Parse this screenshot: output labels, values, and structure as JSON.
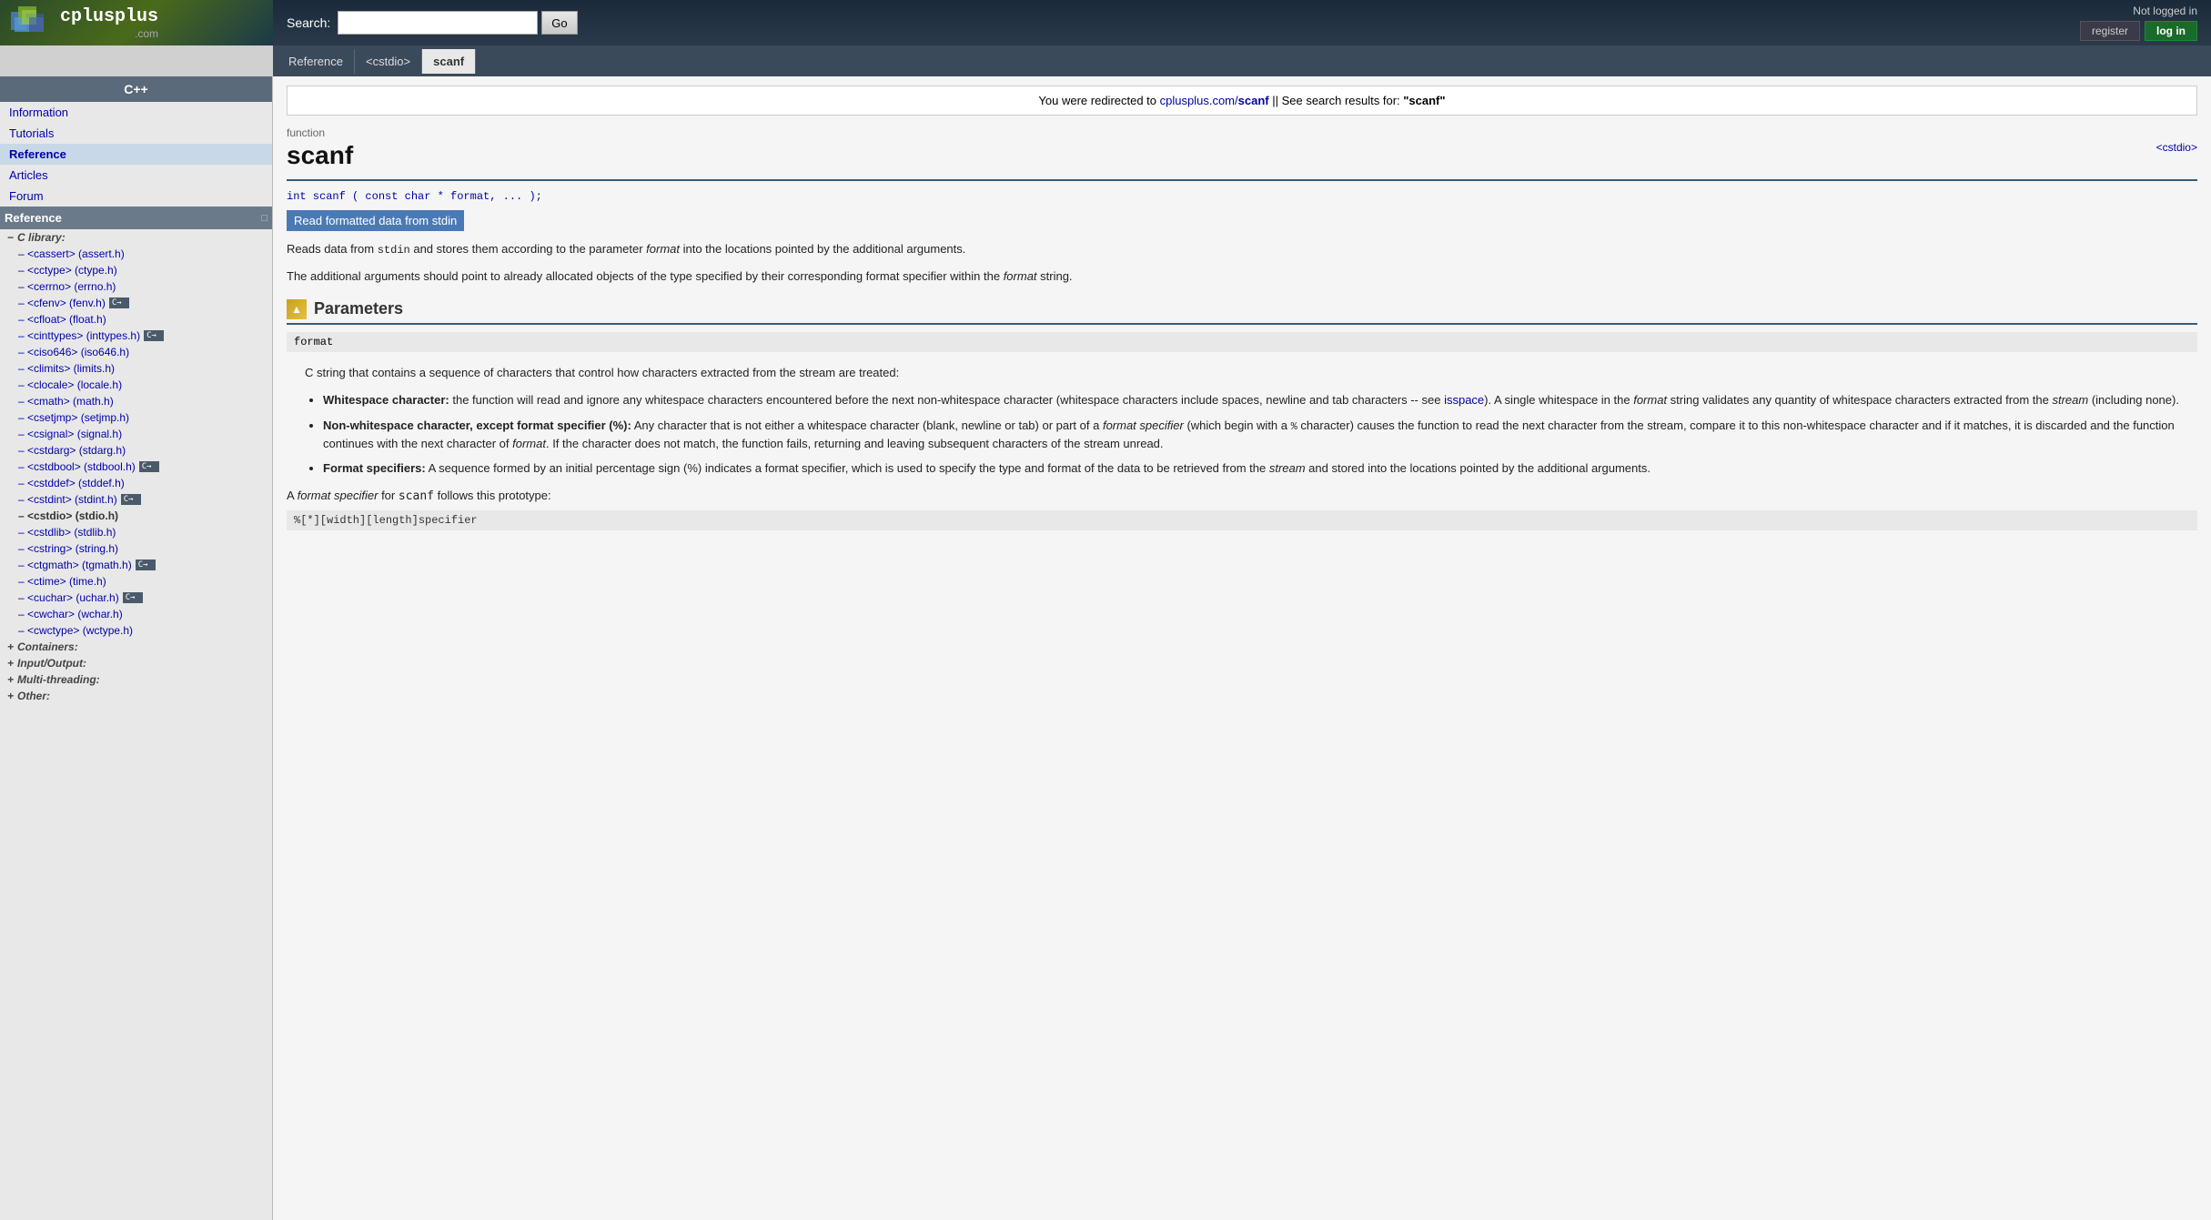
{
  "header": {
    "search_label": "Search:",
    "search_placeholder": "",
    "search_button": "Go",
    "not_logged_in": "Not logged in",
    "register": "register",
    "login": "log in",
    "logo_text": "cplusplus",
    "logo_dot_com": ".com"
  },
  "breadcrumb": {
    "items": [
      "Reference",
      "<cstdio>",
      "scanf"
    ]
  },
  "sidebar": {
    "cpp_section": "C++",
    "nav_items": [
      {
        "label": "Information",
        "bold": false
      },
      {
        "label": "Tutorials",
        "bold": false
      },
      {
        "label": "Reference",
        "bold": true
      },
      {
        "label": "Articles",
        "bold": false
      },
      {
        "label": "Forum",
        "bold": false
      }
    ],
    "reference_section": "Reference",
    "tree": {
      "c_library_label": "C library:",
      "items": [
        {
          "label": "<cassert> (assert.h)",
          "indent": true,
          "c11": false,
          "active": false
        },
        {
          "label": "<cctype> (ctype.h)",
          "indent": true,
          "c11": false,
          "active": false
        },
        {
          "label": "<cerrno> (errno.h)",
          "indent": true,
          "c11": false,
          "active": false
        },
        {
          "label": "<cfenv> (fenv.h)",
          "indent": true,
          "c11": true,
          "active": false
        },
        {
          "label": "<cfloat> (float.h)",
          "indent": true,
          "c11": false,
          "active": false
        },
        {
          "label": "<cinttypes> (inttypes.h)",
          "indent": true,
          "c11": true,
          "active": false
        },
        {
          "label": "<ciso646> (iso646.h)",
          "indent": true,
          "c11": false,
          "active": false
        },
        {
          "label": "<climits> (limits.h)",
          "indent": true,
          "c11": false,
          "active": false
        },
        {
          "label": "<clocale> (locale.h)",
          "indent": true,
          "c11": false,
          "active": false
        },
        {
          "label": "<cmath> (math.h)",
          "indent": true,
          "c11": false,
          "active": false
        },
        {
          "label": "<csetjmp> (setjmp.h)",
          "indent": true,
          "c11": false,
          "active": false
        },
        {
          "label": "<csignal> (signal.h)",
          "indent": true,
          "c11": false,
          "active": false
        },
        {
          "label": "<cstdarg> (stdarg.h)",
          "indent": true,
          "c11": false,
          "active": false
        },
        {
          "label": "<cstdbool> (stdbool.h)",
          "indent": true,
          "c11": true,
          "active": false
        },
        {
          "label": "<cstddef> (stddef.h)",
          "indent": true,
          "c11": false,
          "active": false
        },
        {
          "label": "<cstdint> (stdint.h)",
          "indent": true,
          "c11": true,
          "active": false
        },
        {
          "label": "<cstdio> (stdio.h)",
          "indent": true,
          "c11": false,
          "active": true
        },
        {
          "label": "<cstdlib> (stdlib.h)",
          "indent": true,
          "c11": false,
          "active": false
        },
        {
          "label": "<cstring> (string.h)",
          "indent": true,
          "c11": false,
          "active": false
        },
        {
          "label": "<ctgmath> (tgmath.h)",
          "indent": true,
          "c11": true,
          "active": false
        },
        {
          "label": "<ctime> (time.h)",
          "indent": true,
          "c11": false,
          "active": false
        },
        {
          "label": "<cuchar> (uchar.h)",
          "indent": true,
          "c11": true,
          "active": false
        },
        {
          "label": "<cwchar> (wchar.h)",
          "indent": true,
          "c11": false,
          "active": false
        },
        {
          "label": "<cwctype> (wctype.h)",
          "indent": true,
          "c11": false,
          "active": false
        }
      ],
      "containers_label": "Containers:",
      "input_output_label": "Input/Output:",
      "multi_threading_label": "Multi-threading:",
      "other_label": "Other:"
    }
  },
  "main": {
    "redirect_notice_1": "You were redirected to cplusplus.com/",
    "redirect_bold": "scanf",
    "redirect_notice_2": " || See search results for: ",
    "redirect_search": "\"scanf\"",
    "function_type": "function",
    "function_name": "scanf",
    "cstdio_link": "<cstdio>",
    "syntax": "int scanf ( const char * format, ... );",
    "description_highlight": "Read formatted data from stdin",
    "desc1": "Reads data from stdin and stores them according to the parameter format into the locations pointed by the additional arguments.",
    "desc2": "The additional arguments should point to already allocated objects of the type specified by their corresponding format specifier within the format string.",
    "parameters_title": "Parameters",
    "format_param": "format",
    "format_desc": "C string that contains a sequence of characters that control how characters extracted from the stream are treated:",
    "bullets": [
      {
        "title": "Whitespace character:",
        "text": " the function will read and ignore any whitespace characters encountered before the next non-whitespace character (whitespace characters include spaces, newline and tab characters -- see isspace). A single whitespace in the format string validates any quantity of whitespace characters extracted from the stream (including none)."
      },
      {
        "title": "Non-whitespace character, except format specifier (%):",
        "text": " Any character that is not either a whitespace character (blank, newline or tab) or part of a format specifier (which begin with a % character) causes the function to read the next character from the stream, compare it to this non-whitespace character and if it matches, it is discarded and the function continues with the next character of format. If the character does not match, the function fails, returning and leaving subsequent characters of the stream unread."
      },
      {
        "title": "Format specifiers:",
        "text": " A sequence formed by an initial percentage sign (%) indicates a format specifier, which is used to specify the type and format of the data to be retrieved from the stream and stored into the locations pointed by the additional arguments."
      }
    ],
    "format_specifier_intro": "A format specifier for scanf follows this prototype:",
    "format_specifier_code": "%[*][width][length]specifier"
  }
}
